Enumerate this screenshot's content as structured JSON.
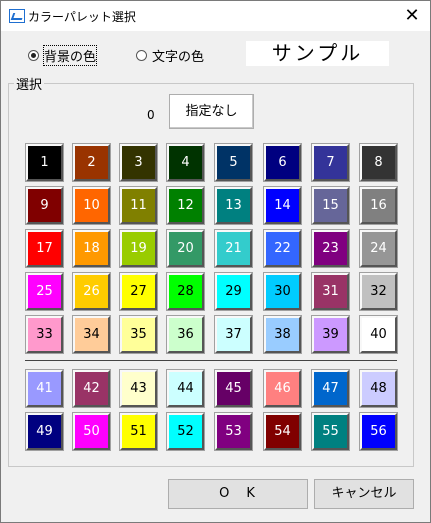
{
  "window": {
    "title": "カラーパレット選択",
    "close_glyph": "✕"
  },
  "radios": {
    "background": {
      "label": "背景の色",
      "selected": true
    },
    "text": {
      "label": "文字の色",
      "selected": false
    }
  },
  "sample_text": "サンプル",
  "group": {
    "label": "選択",
    "zero_label": "0",
    "none_button": "指定なし"
  },
  "swatches": [
    {
      "label": "1",
      "bg": "#000000",
      "fg": "#ffffff"
    },
    {
      "label": "2",
      "bg": "#993300",
      "fg": "#ffffff"
    },
    {
      "label": "3",
      "bg": "#333300",
      "fg": "#ffffff"
    },
    {
      "label": "4",
      "bg": "#003300",
      "fg": "#ffffff"
    },
    {
      "label": "5",
      "bg": "#003366",
      "fg": "#ffffff"
    },
    {
      "label": "6",
      "bg": "#000080",
      "fg": "#ffffff"
    },
    {
      "label": "7",
      "bg": "#333399",
      "fg": "#ffffff"
    },
    {
      "label": "8",
      "bg": "#333333",
      "fg": "#ffffff"
    },
    {
      "label": "9",
      "bg": "#800000",
      "fg": "#ffffff"
    },
    {
      "label": "10",
      "bg": "#ff6600",
      "fg": "#ffffff"
    },
    {
      "label": "11",
      "bg": "#808000",
      "fg": "#ffffff"
    },
    {
      "label": "12",
      "bg": "#008000",
      "fg": "#ffffff"
    },
    {
      "label": "13",
      "bg": "#008080",
      "fg": "#ffffff"
    },
    {
      "label": "14",
      "bg": "#0000ff",
      "fg": "#ffffff"
    },
    {
      "label": "15",
      "bg": "#666699",
      "fg": "#ffffff"
    },
    {
      "label": "16",
      "bg": "#808080",
      "fg": "#ffffff"
    },
    {
      "label": "17",
      "bg": "#ff0000",
      "fg": "#ffffff"
    },
    {
      "label": "18",
      "bg": "#ff9900",
      "fg": "#ffffff"
    },
    {
      "label": "19",
      "bg": "#99cc00",
      "fg": "#ffffff"
    },
    {
      "label": "20",
      "bg": "#339966",
      "fg": "#ffffff"
    },
    {
      "label": "21",
      "bg": "#33cccc",
      "fg": "#ffffff"
    },
    {
      "label": "22",
      "bg": "#3366ff",
      "fg": "#ffffff"
    },
    {
      "label": "23",
      "bg": "#800080",
      "fg": "#ffffff"
    },
    {
      "label": "24",
      "bg": "#969696",
      "fg": "#ffffff"
    },
    {
      "label": "25",
      "bg": "#ff00ff",
      "fg": "#ffffff"
    },
    {
      "label": "26",
      "bg": "#ffcc00",
      "fg": "#ffffff"
    },
    {
      "label": "27",
      "bg": "#ffff00",
      "fg": "#000000"
    },
    {
      "label": "28",
      "bg": "#00ff00",
      "fg": "#000000"
    },
    {
      "label": "29",
      "bg": "#00ffff",
      "fg": "#000000"
    },
    {
      "label": "30",
      "bg": "#00ccff",
      "fg": "#000000"
    },
    {
      "label": "31",
      "bg": "#993366",
      "fg": "#ffffff"
    },
    {
      "label": "32",
      "bg": "#c0c0c0",
      "fg": "#000000"
    },
    {
      "label": "33",
      "bg": "#ff99cc",
      "fg": "#000000"
    },
    {
      "label": "34",
      "bg": "#ffcc99",
      "fg": "#000000"
    },
    {
      "label": "35",
      "bg": "#ffff99",
      "fg": "#000000"
    },
    {
      "label": "36",
      "bg": "#ccffcc",
      "fg": "#000000"
    },
    {
      "label": "37",
      "bg": "#ccffff",
      "fg": "#000000"
    },
    {
      "label": "38",
      "bg": "#99ccff",
      "fg": "#000000"
    },
    {
      "label": "39",
      "bg": "#cc99ff",
      "fg": "#000000"
    },
    {
      "label": "40",
      "bg": "#ffffff",
      "fg": "#000000"
    },
    {
      "label": "41",
      "bg": "#9999ff",
      "fg": "#ffffff"
    },
    {
      "label": "42",
      "bg": "#993366",
      "fg": "#ffffff"
    },
    {
      "label": "43",
      "bg": "#ffffcc",
      "fg": "#000000"
    },
    {
      "label": "44",
      "bg": "#ccffff",
      "fg": "#000000"
    },
    {
      "label": "45",
      "bg": "#660066",
      "fg": "#ffffff"
    },
    {
      "label": "46",
      "bg": "#ff8080",
      "fg": "#ffffff"
    },
    {
      "label": "47",
      "bg": "#0066cc",
      "fg": "#ffffff"
    },
    {
      "label": "48",
      "bg": "#ccccff",
      "fg": "#000000"
    },
    {
      "label": "49",
      "bg": "#000080",
      "fg": "#ffffff"
    },
    {
      "label": "50",
      "bg": "#ff00ff",
      "fg": "#ffffff"
    },
    {
      "label": "51",
      "bg": "#ffff00",
      "fg": "#000000"
    },
    {
      "label": "52",
      "bg": "#00ffff",
      "fg": "#000000"
    },
    {
      "label": "53",
      "bg": "#800080",
      "fg": "#ffffff"
    },
    {
      "label": "54",
      "bg": "#800000",
      "fg": "#ffffff"
    },
    {
      "label": "55",
      "bg": "#008080",
      "fg": "#ffffff"
    },
    {
      "label": "56",
      "bg": "#0000ff",
      "fg": "#ffffff"
    }
  ],
  "buttons": {
    "ok": "O　K",
    "cancel": "キャンセル"
  }
}
